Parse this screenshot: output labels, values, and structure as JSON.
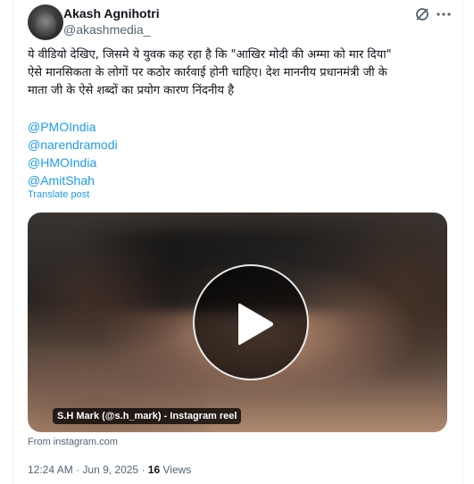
{
  "author": {
    "name": "Akash Agnihotri",
    "handle": "@akashmedia_"
  },
  "icons": {
    "grok": "grok-icon",
    "more": "more-icon",
    "play": "play-icon"
  },
  "tweet": {
    "text_line_1": "ये वीडियो देखिए, जिसमे ये युवक कह रहा है कि \"आखिर मोदी की अम्मा को मार दिया\"",
    "text_line_2": "ऐसे मानसिकता के लोगों पर कठोर कार्रवाई होनी चाहिए। देश माननीय प्रधानमंत्री जी के",
    "text_line_3": "माता जी के ऐसे शब्दों का प्रयोग कारण निंदनीय है",
    "mentions": [
      "@PMOIndia",
      "@narendramodi",
      "@HMOIndia",
      "@AmitShah"
    ],
    "translate_label": "Translate post"
  },
  "media": {
    "caption": "S.H Mark (@s.h_mark) - Instagram reel",
    "source": "From instagram.com"
  },
  "meta": {
    "time": "12:24 AM",
    "separator": "·",
    "date": "Jun 9, 2025",
    "views_count": "16",
    "views_label": "Views"
  },
  "colors": {
    "link": "#1d9bf0",
    "secondary_text": "#536471",
    "primary_text": "#0f1419"
  }
}
